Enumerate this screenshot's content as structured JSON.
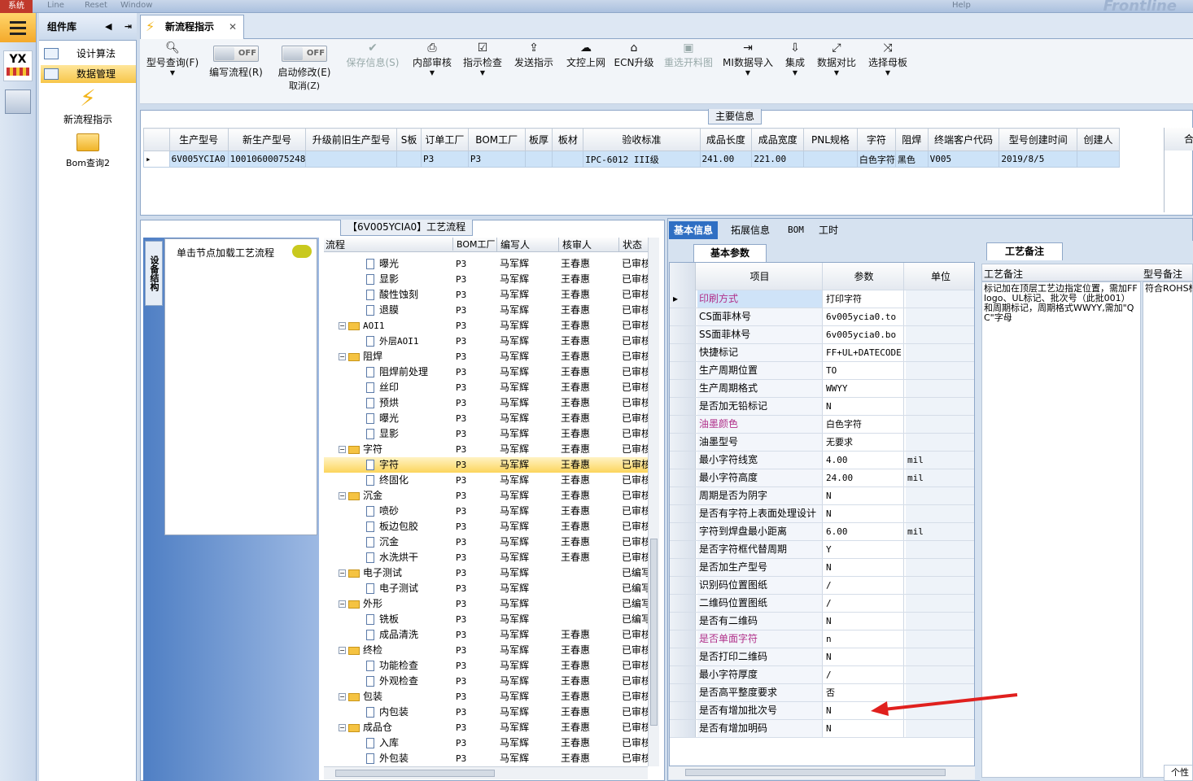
{
  "topbar": {
    "system": "系统",
    "menu1": "Line",
    "menu2": "Reset",
    "menu3": "Window",
    "right1": "Help",
    "logo": "Frontline"
  },
  "left_icons": {
    "yx": "YX"
  },
  "component_panel": {
    "title": "组件库",
    "items": [
      {
        "label": "设计算法",
        "selected": false
      },
      {
        "label": "数据管理",
        "selected": true
      }
    ],
    "shortcuts": [
      {
        "label": "新流程指示",
        "icon": "lightning-icon"
      },
      {
        "label": "Bom查询2",
        "icon": "folder-icon"
      }
    ]
  },
  "doc_tab": {
    "label": "新流程指示"
  },
  "toolbar": {
    "type_query": "型号查询(F)",
    "edit_flow": "编写流程(R)",
    "toggle_off": "OFF",
    "start_modify": "启动修改(E)",
    "cancel": "取消(Z)",
    "save_info": "保存信息(S)",
    "internal_review": "内部审核",
    "instr_check": "指示检查",
    "send_instr": "发送指示",
    "doc_upload": "文控上网",
    "ecn_upgrade": "ECN升级",
    "reselect": "重选开料图",
    "mi_import": "MI数据导入",
    "integrate": "集成",
    "data_compare": "数据对比",
    "select_master": "选择母板"
  },
  "main_info": {
    "group_title": "主要信息",
    "columns": [
      "生产型号",
      "新生产型号",
      "升级前旧生产型号",
      "S板",
      "订单工厂",
      "BOM工厂",
      "板厚",
      "板材",
      "验收标准",
      "成品长度",
      "成品宽度",
      "PNL规格",
      "字符",
      "阻焊",
      "终端客户代码",
      "型号创建时间",
      "创建人"
    ],
    "row": [
      "6V005YCIA0",
      "10010600075248",
      "",
      "",
      "P3",
      "P3",
      "",
      "",
      "IPC-6012 III级",
      "241.00",
      "221.00",
      "",
      "白色字符",
      "黑色",
      "V005",
      "2019/8/5",
      ""
    ],
    "extra_col": "合"
  },
  "process_panel": {
    "title": "【6V005YCIA0】工艺流程",
    "vertical_tab": "设备结构",
    "load_hint": "单击节点加载工艺流程",
    "tree_cols": [
      "流程",
      "BOM工厂",
      "编写人",
      "核审人",
      "状态"
    ],
    "rows": [
      {
        "name": "曝光",
        "depth": 2,
        "type": "doc",
        "bom": "P3",
        "writer": "马军辉",
        "reviewer": "王春惠",
        "status": "已审核"
      },
      {
        "name": "显影",
        "depth": 2,
        "type": "doc",
        "bom": "P3",
        "writer": "马军辉",
        "reviewer": "王春惠",
        "status": "已审核"
      },
      {
        "name": "酸性蚀刻",
        "depth": 2,
        "type": "doc",
        "bom": "P3",
        "writer": "马军辉",
        "reviewer": "王春惠",
        "status": "已审核"
      },
      {
        "name": "退膜",
        "depth": 2,
        "type": "doc",
        "bom": "P3",
        "writer": "马军辉",
        "reviewer": "王春惠",
        "status": "已审核"
      },
      {
        "name": "AOI1",
        "depth": 1,
        "type": "folder",
        "bom": "P3",
        "writer": "马军辉",
        "reviewer": "王春惠",
        "status": "已审核"
      },
      {
        "name": "外层AOI1",
        "depth": 2,
        "type": "doc",
        "bom": "P3",
        "writer": "马军辉",
        "reviewer": "王春惠",
        "status": "已审核"
      },
      {
        "name": "阻焊",
        "depth": 1,
        "type": "folder",
        "bom": "P3",
        "writer": "马军辉",
        "reviewer": "王春惠",
        "status": "已审核"
      },
      {
        "name": "阻焊前处理",
        "depth": 2,
        "type": "doc",
        "bom": "P3",
        "writer": "马军辉",
        "reviewer": "王春惠",
        "status": "已审核"
      },
      {
        "name": "丝印",
        "depth": 2,
        "type": "doc",
        "bom": "P3",
        "writer": "马军辉",
        "reviewer": "王春惠",
        "status": "已审核"
      },
      {
        "name": "预烘",
        "depth": 2,
        "type": "doc",
        "bom": "P3",
        "writer": "马军辉",
        "reviewer": "王春惠",
        "status": "已审核"
      },
      {
        "name": "曝光",
        "depth": 2,
        "type": "doc",
        "bom": "P3",
        "writer": "马军辉",
        "reviewer": "王春惠",
        "status": "已审核"
      },
      {
        "name": "显影",
        "depth": 2,
        "type": "doc",
        "bom": "P3",
        "writer": "马军辉",
        "reviewer": "王春惠",
        "status": "已审核"
      },
      {
        "name": "字符",
        "depth": 1,
        "type": "folder",
        "bom": "P3",
        "writer": "马军辉",
        "reviewer": "王春惠",
        "status": "已审核"
      },
      {
        "name": "字符",
        "depth": 2,
        "type": "doc",
        "bom": "P3",
        "writer": "马军辉",
        "reviewer": "王春惠",
        "status": "已审核",
        "selected": true
      },
      {
        "name": "终固化",
        "depth": 2,
        "type": "doc",
        "bom": "P3",
        "writer": "马军辉",
        "reviewer": "王春惠",
        "status": "已审核"
      },
      {
        "name": "沉金",
        "depth": 1,
        "type": "folder",
        "bom": "P3",
        "writer": "马军辉",
        "reviewer": "王春惠",
        "status": "已审核"
      },
      {
        "name": "喷砂",
        "depth": 2,
        "type": "doc",
        "bom": "P3",
        "writer": "马军辉",
        "reviewer": "王春惠",
        "status": "已审核"
      },
      {
        "name": "板边包胶",
        "depth": 2,
        "type": "doc",
        "bom": "P3",
        "writer": "马军辉",
        "reviewer": "王春惠",
        "status": "已审核"
      },
      {
        "name": "沉金",
        "depth": 2,
        "type": "doc",
        "bom": "P3",
        "writer": "马军辉",
        "reviewer": "王春惠",
        "status": "已审核"
      },
      {
        "name": "水洗烘干",
        "depth": 2,
        "type": "doc",
        "bom": "P3",
        "writer": "马军辉",
        "reviewer": "王春惠",
        "status": "已审核"
      },
      {
        "name": "电子测试",
        "depth": 1,
        "type": "folder",
        "bom": "P3",
        "writer": "马军辉",
        "reviewer": "",
        "status": "已编写"
      },
      {
        "name": "电子测试",
        "depth": 2,
        "type": "doc",
        "bom": "P3",
        "writer": "马军辉",
        "reviewer": "",
        "status": "已编写"
      },
      {
        "name": "外形",
        "depth": 1,
        "type": "folder",
        "bom": "P3",
        "writer": "马军辉",
        "reviewer": "",
        "status": "已编写"
      },
      {
        "name": "铣板",
        "depth": 2,
        "type": "doc",
        "bom": "P3",
        "writer": "马军辉",
        "reviewer": "",
        "status": "已编写"
      },
      {
        "name": "成品清洗",
        "depth": 2,
        "type": "doc",
        "bom": "P3",
        "writer": "马军辉",
        "reviewer": "王春惠",
        "status": "已审核"
      },
      {
        "name": "终检",
        "depth": 1,
        "type": "folder",
        "bom": "P3",
        "writer": "马军辉",
        "reviewer": "王春惠",
        "status": "已审核"
      },
      {
        "name": "功能检查",
        "depth": 2,
        "type": "doc",
        "bom": "P3",
        "writer": "马军辉",
        "reviewer": "王春惠",
        "status": "已审核"
      },
      {
        "name": "外观检查",
        "depth": 2,
        "type": "doc",
        "bom": "P3",
        "writer": "马军辉",
        "reviewer": "王春惠",
        "status": "已审核"
      },
      {
        "name": "包装",
        "depth": 1,
        "type": "folder",
        "bom": "P3",
        "writer": "马军辉",
        "reviewer": "王春惠",
        "status": "已审核"
      },
      {
        "name": "内包装",
        "depth": 2,
        "type": "doc",
        "bom": "P3",
        "writer": "马军辉",
        "reviewer": "王春惠",
        "status": "已审核"
      },
      {
        "name": "成品仓",
        "depth": 1,
        "type": "folder",
        "bom": "P3",
        "writer": "马军辉",
        "reviewer": "王春惠",
        "status": "已审核"
      },
      {
        "name": "入库",
        "depth": 2,
        "type": "doc",
        "bom": "P3",
        "writer": "马军辉",
        "reviewer": "王春惠",
        "status": "已审核"
      },
      {
        "name": "外包装",
        "depth": 2,
        "type": "doc",
        "bom": "P3",
        "writer": "马军辉",
        "reviewer": "王春惠",
        "status": "已审核"
      }
    ]
  },
  "right_tabs": [
    "基本信息",
    "拓展信息",
    "BOM",
    "工时"
  ],
  "params": {
    "subtab": "基本参数",
    "cols": [
      "项目",
      "参数",
      "单位"
    ],
    "rows": [
      {
        "item": "印刷方式",
        "value": "打印字符",
        "unit": "",
        "pink": true,
        "selected": true
      },
      {
        "item": "CS面菲林号",
        "value": "6v005ycia0.to",
        "unit": ""
      },
      {
        "item": "SS面菲林号",
        "value": "6v005ycia0.bo",
        "unit": ""
      },
      {
        "item": "快捷标记",
        "value": "FF+UL+DATECODE",
        "unit": ""
      },
      {
        "item": "生产周期位置",
        "value": "TO",
        "unit": ""
      },
      {
        "item": "生产周期格式",
        "value": "WWYY",
        "unit": ""
      },
      {
        "item": "是否加无铅标记",
        "value": "N",
        "unit": ""
      },
      {
        "item": "油墨颜色",
        "value": "白色字符",
        "unit": "",
        "pink": true
      },
      {
        "item": "油墨型号",
        "value": "无要求",
        "unit": ""
      },
      {
        "item": "最小字符线宽",
        "value": "4.00",
        "unit": "mil"
      },
      {
        "item": "最小字符高度",
        "value": "24.00",
        "unit": "mil"
      },
      {
        "item": "周期是否为阴字",
        "value": "N",
        "unit": ""
      },
      {
        "item": "是否有字符上表面处理设计",
        "value": "N",
        "unit": ""
      },
      {
        "item": "字符到焊盘最小距离",
        "value": "6.00",
        "unit": "mil"
      },
      {
        "item": "是否字符框代替周期",
        "value": "Y",
        "unit": ""
      },
      {
        "item": "是否加生产型号",
        "value": "N",
        "unit": ""
      },
      {
        "item": "识别码位置图纸",
        "value": "/",
        "unit": ""
      },
      {
        "item": "二维码位置图纸",
        "value": "/",
        "unit": ""
      },
      {
        "item": "是否有二维码",
        "value": "N",
        "unit": ""
      },
      {
        "item": "是否单面字符",
        "value": "n",
        "unit": "",
        "pink": true
      },
      {
        "item": "是否打印二维码",
        "value": "N",
        "unit": ""
      },
      {
        "item": "最小字符厚度",
        "value": "/",
        "unit": ""
      },
      {
        "item": "是否高平整度要求",
        "value": "否",
        "unit": ""
      },
      {
        "item": "是否有增加批次号",
        "value": "N",
        "unit": ""
      },
      {
        "item": "是否有增加明码",
        "value": "N",
        "unit": ""
      }
    ]
  },
  "remarks": {
    "tab": "工艺备注",
    "col1": "工艺备注",
    "col2": "型号备注",
    "text1": "标记加在顶层工艺边指定位置，需加FF logo、UL标记、批次号（此批001）和周期标记，周期格式WWYY,需加\"QC\"字母",
    "text2": "符合ROHS标",
    "bottom_right": "个性"
  },
  "colors": {
    "accent": "#2f6fc3",
    "selection": "#fcd55c",
    "arrow": "#e0201e"
  }
}
